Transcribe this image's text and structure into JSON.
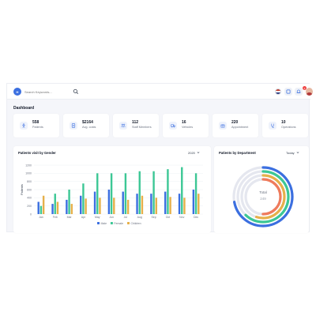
{
  "header": {
    "logo_text": "H",
    "search": {
      "placeholder": "Search Keywords..."
    },
    "notification_count": "2"
  },
  "page_title": "Dashboard",
  "stats": [
    {
      "value": "558",
      "label": "Patients",
      "icon": "accessibility-icon"
    },
    {
      "value": "$2164",
      "label": "Avg. costs",
      "icon": "invoice-icon"
    },
    {
      "value": "112",
      "label": "Staff Members",
      "icon": "staff-icon"
    },
    {
      "value": "16",
      "label": "Vehicles",
      "icon": "ambulance-icon"
    },
    {
      "value": "220",
      "label": "Appointment",
      "icon": "gift-calendar-icon"
    },
    {
      "value": "10",
      "label": "Operations",
      "icon": "operations-icon"
    }
  ],
  "gender_panel": {
    "title": "Patients visit by Gender",
    "selected_year": "2020"
  },
  "department_panel": {
    "title": "Patients by Department",
    "selected_period": "Today",
    "center_label": "Total",
    "center_value": "249"
  },
  "colors": {
    "male": "#3b6fe0",
    "female": "#3cc795",
    "children": "#e6b04a",
    "brand": "#3b6fe0"
  },
  "chart_data": [
    {
      "type": "bar",
      "title": "Patients visit by Gender",
      "categories": [
        "Jan",
        "Feb",
        "Mar",
        "Apr",
        "May",
        "Jun",
        "Jul",
        "Aug",
        "Sep",
        "Oct",
        "Nov",
        "Dec"
      ],
      "series": [
        {
          "name": "Male",
          "values": [
            300,
            250,
            350,
            450,
            550,
            600,
            550,
            500,
            500,
            550,
            500,
            600
          ]
        },
        {
          "name": "Female",
          "values": [
            200,
            500,
            600,
            750,
            1000,
            1000,
            1000,
            1050,
            1050,
            1100,
            1150,
            1000
          ]
        },
        {
          "name": "Children",
          "values": [
            450,
            300,
            250,
            380,
            400,
            400,
            350,
            450,
            400,
            420,
            400,
            500
          ]
        }
      ],
      "xlabel": "",
      "ylabel": "Patients",
      "yticks": [
        0,
        200,
        400,
        600,
        800,
        1000,
        1200
      ],
      "ylim": [
        0,
        1200
      ],
      "grid": true,
      "legend": "bottom"
    },
    {
      "type": "radial-bar",
      "title": "Patients by Department",
      "center_label": "Total",
      "center_value": "249",
      "rings": [
        {
          "color": "#3b6fe0",
          "value": 0.72
        },
        {
          "color": "#3cc795",
          "value": 0.62
        },
        {
          "color": "#e6b04a",
          "value": 0.55
        },
        {
          "color": "#ef7b5c",
          "value": 0.5
        }
      ]
    }
  ]
}
